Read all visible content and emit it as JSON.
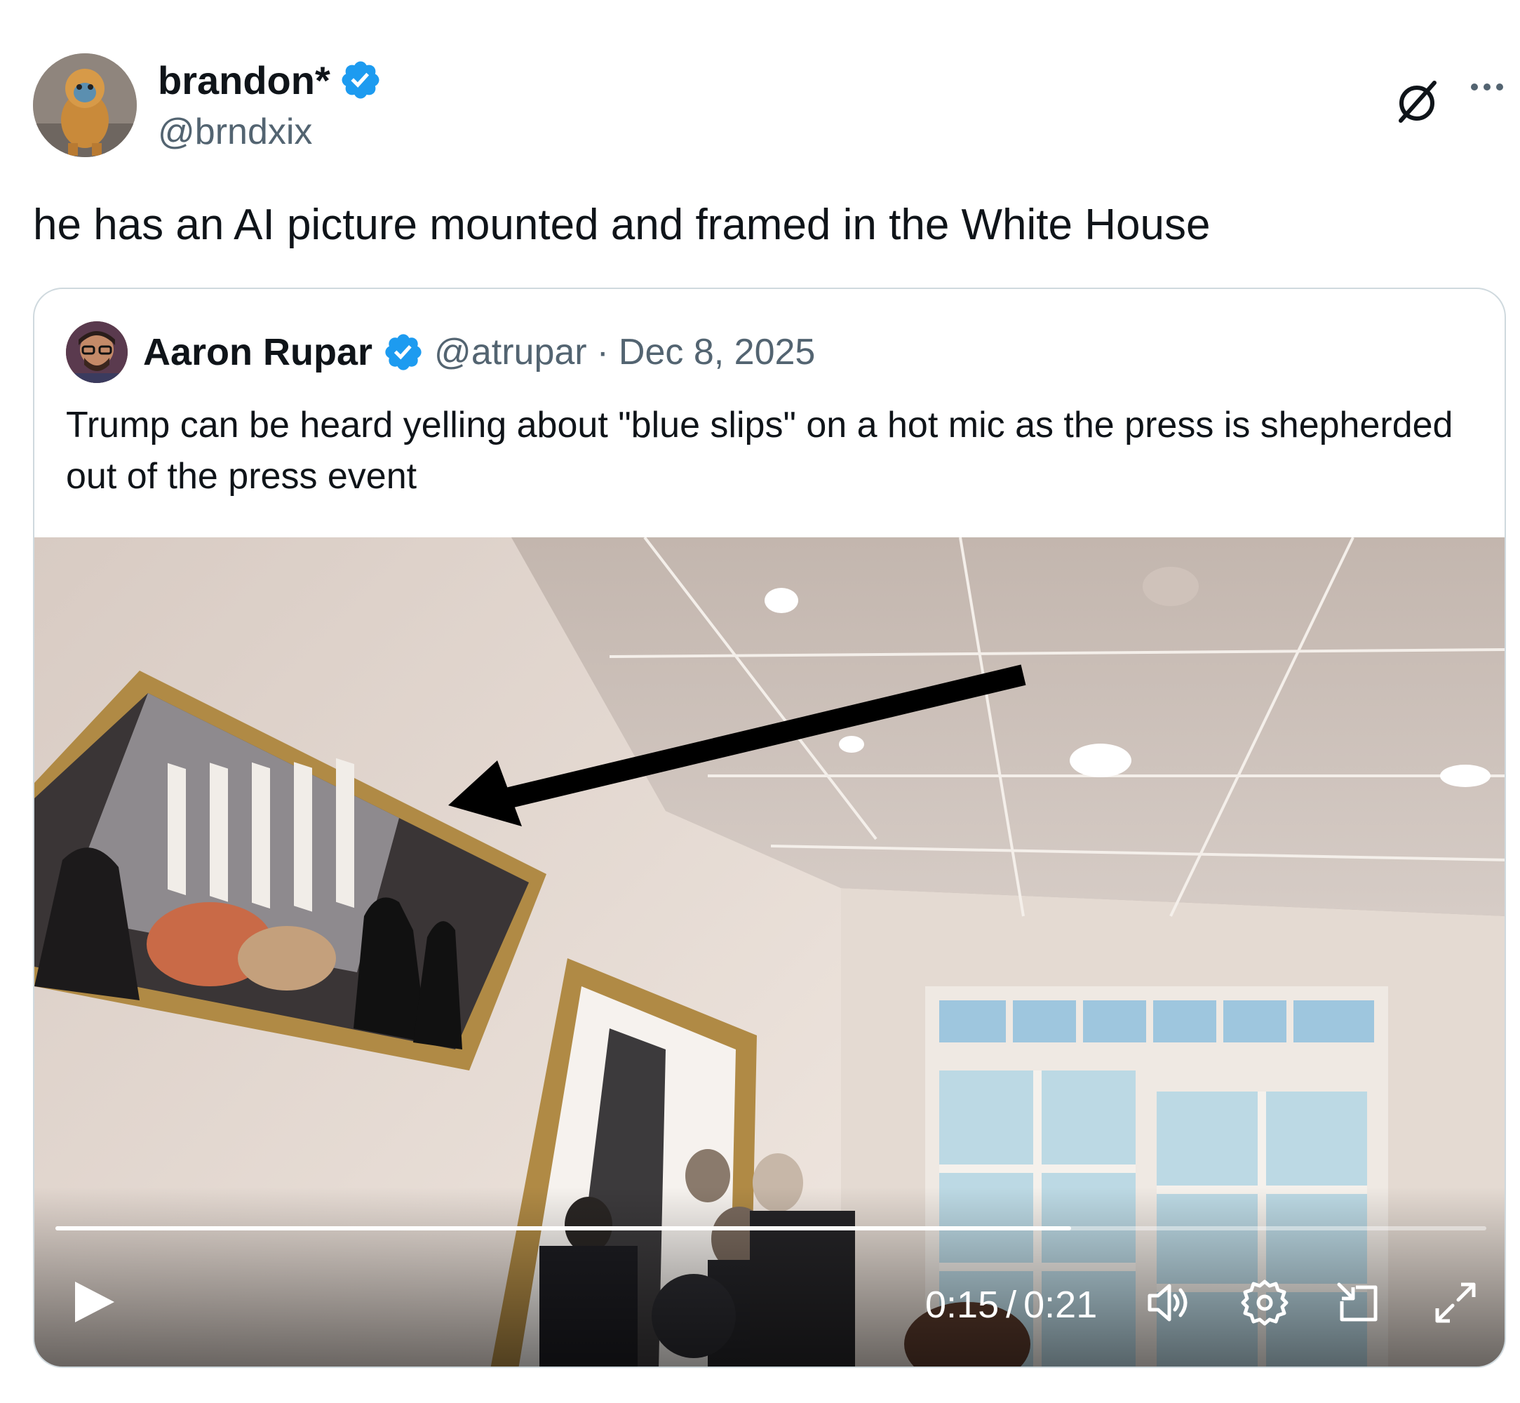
{
  "post": {
    "author_name": "brandon*",
    "author_handle": "@brndxix",
    "verified": true,
    "text": "he has an AI picture mounted and framed in the White House",
    "icons": {
      "grok": "grok-icon",
      "more": "more-icon"
    }
  },
  "quoted_post": {
    "author_name": "Aaron Rupar",
    "author_handle": "@atrupar",
    "separator": "·",
    "date": "Dec 8, 2025",
    "verified": true,
    "text": "Trump can be heard yelling about \"blue slips\" on a hot mic as the press is shepherded out of the press event",
    "video": {
      "current_time": "0:15",
      "time_separator": "/",
      "duration": "0:21",
      "progress_fraction": 0.71,
      "icons": [
        "play-icon",
        "volume-icon",
        "settings-icon",
        "picture-in-picture-icon",
        "fullscreen-icon"
      ]
    }
  },
  "colors": {
    "text_primary": "#0f1419",
    "text_secondary": "#536471",
    "verified_blue": "#1d9bf0",
    "card_border": "#cfd9de"
  }
}
